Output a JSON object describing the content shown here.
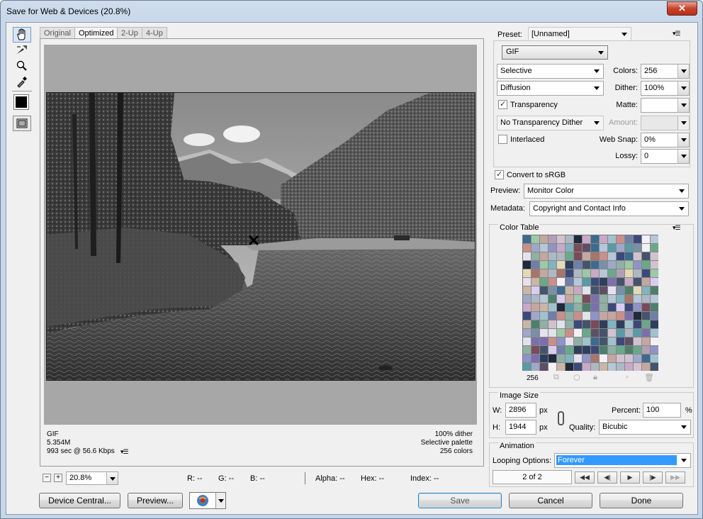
{
  "window": {
    "title": "Save for Web & Devices (20.8%)",
    "close": "✕"
  },
  "tools": [
    {
      "name": "hand-tool-icon",
      "glyph": "✋"
    },
    {
      "name": "slice-select-tool-icon",
      "glyph": "➚"
    },
    {
      "name": "zoom-tool-icon",
      "glyph": "⚲"
    },
    {
      "name": "eyedropper-tool-icon",
      "glyph": "✎"
    }
  ],
  "tabs": {
    "original": "Original",
    "optimized": "Optimized",
    "two_up": "2-Up",
    "four_up": "4-Up"
  },
  "info_left": {
    "format": "GIF",
    "size": "5.354M",
    "time": "993 sec @ 56.6 Kbps"
  },
  "info_right": {
    "dither": "100% dither",
    "palette": "Selective palette",
    "colors": "256 colors"
  },
  "statusbar": {
    "zoom": "20.8%",
    "r": "R: --",
    "g": "G: --",
    "b": "B: --",
    "alpha": "Alpha: --",
    "hex": "Hex: --",
    "index": "Index: --"
  },
  "buttons": {
    "device_central": "Device Central...",
    "preview": "Preview...",
    "save": "Save",
    "cancel": "Cancel",
    "done": "Done"
  },
  "settings": {
    "preset_label": "Preset:",
    "preset_value": "[Unnamed]",
    "format": "GIF",
    "reduction": "Selective",
    "colors_label": "Colors:",
    "colors_value": "256",
    "dither_algo": "Diffusion",
    "dither_label": "Dither:",
    "dither_value": "100%",
    "transparency_label": "Transparency",
    "transparency_checked": true,
    "matte_label": "Matte:",
    "transparency_dither": "No Transparency Dither",
    "amount_label": "Amount:",
    "interlaced_label": "Interlaced",
    "interlaced_checked": false,
    "websnap_label": "Web Snap:",
    "websnap_value": "0%",
    "lossy_label": "Lossy:",
    "lossy_value": "0",
    "srgb_label": "Convert to sRGB",
    "srgb_checked": true,
    "preview_label": "Preview:",
    "preview_value": "Monitor Color",
    "metadata_label": "Metadata:",
    "metadata_value": "Copyright and Contact Info"
  },
  "color_table": {
    "title": "Color Table",
    "count": "256"
  },
  "image_size": {
    "title": "Image Size",
    "w_label": "W:",
    "w_value": "2896",
    "h_label": "H:",
    "h_value": "1944",
    "unit": "px",
    "percent_label": "Percent:",
    "percent_value": "100",
    "percent_unit": "%",
    "quality_label": "Quality:",
    "quality_value": "Bicubic"
  },
  "animation": {
    "title": "Animation",
    "looping_label": "Looping Options:",
    "looping_value": "Forever",
    "frame": "2 of 2"
  },
  "colors": {
    "accent": "#3399ff",
    "selection": "#3a8ee6",
    "gray_canvas": "#a7a7a7"
  }
}
